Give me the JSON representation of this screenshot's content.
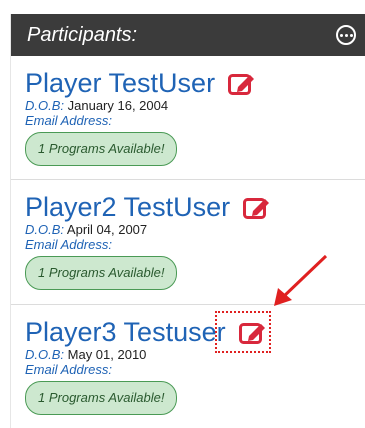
{
  "header": {
    "title": "Participants:",
    "menu_icon": "more-options-circle-icon"
  },
  "labels": {
    "dob": "D.O.B:",
    "email": "Email Address:"
  },
  "participants": [
    {
      "name": "Player TestUser",
      "dob": "January 16, 2004",
      "programs": "1 Programs Available!"
    },
    {
      "name": "Player2 TestUser",
      "dob": "April 04, 2007",
      "programs": "1 Programs Available!"
    },
    {
      "name": "Player3 Testuser",
      "dob": "May 01, 2010",
      "programs": "1 Programs Available!"
    }
  ],
  "colors": {
    "header_bg": "#3b3b3b",
    "name_blue": "#1f63b5",
    "edit_red": "#d8283c",
    "badge_bg": "#cde8cf",
    "badge_border": "#4a9a55",
    "annotation_red": "#e02020"
  }
}
